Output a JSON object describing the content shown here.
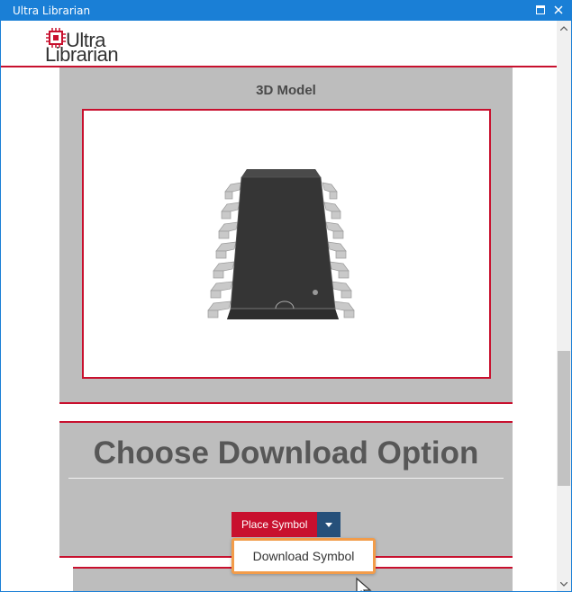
{
  "window": {
    "title": "Ultra Librarian"
  },
  "header": {
    "logo_line1": "Ultra",
    "logo_line2": "Librarian"
  },
  "model_section": {
    "title": "3D Model"
  },
  "download_section": {
    "title": "Choose Download Option",
    "place_button_label": "Place Symbol",
    "dropdown_items": [
      "Download Symbol"
    ]
  },
  "colors": {
    "accent_red": "#c8102e",
    "titlebar_blue": "#1a7fd6",
    "caret_blue": "#26507a",
    "highlight_orange": "#f29c4a"
  }
}
